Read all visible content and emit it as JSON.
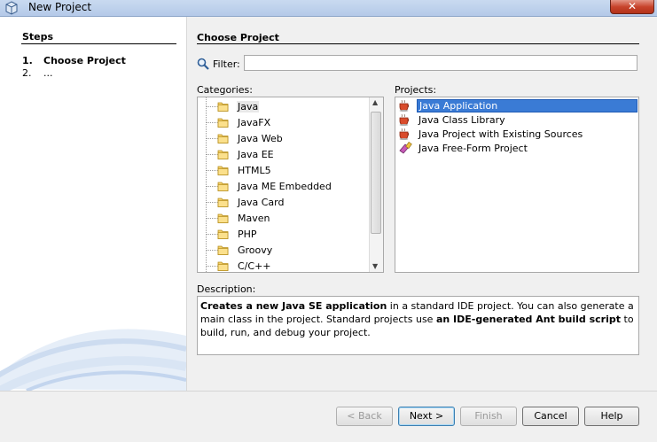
{
  "window": {
    "title": "New Project",
    "close_label": "✕"
  },
  "steps": {
    "header": "Steps",
    "items": [
      {
        "num": "1.",
        "label": "Choose Project"
      },
      {
        "num": "2.",
        "label": "..."
      }
    ]
  },
  "main": {
    "title": "Choose Project",
    "filter": {
      "label": "Filter:",
      "value": "",
      "placeholder": ""
    },
    "categories_label": "Categories:",
    "projects_label": "Projects:",
    "categories": [
      "Java",
      "JavaFX",
      "Java Web",
      "Java EE",
      "HTML5",
      "Java ME Embedded",
      "Java Card",
      "Maven",
      "PHP",
      "Groovy",
      "C/C++"
    ],
    "selected_category": "Java",
    "projects": [
      "Java Application",
      "Java Class Library",
      "Java Project with Existing Sources",
      "Java Free-Form Project"
    ],
    "selected_project": "Java Application",
    "description_label": "Description:",
    "description": {
      "p1": "Creates a new Java SE application",
      "p2": " in a standard IDE project. You can also generate a main class in the project. Standard projects use ",
      "p3": "an IDE-generated Ant build script",
      "p4": " to build, run, and debug your project."
    }
  },
  "buttons": {
    "back": "< Back",
    "next": "Next >",
    "finish": "Finish",
    "cancel": "Cancel",
    "help": "Help"
  },
  "colors": {
    "selection": "#3a7bd5",
    "titlebar": "#c9daf0",
    "close": "#c7432b"
  }
}
